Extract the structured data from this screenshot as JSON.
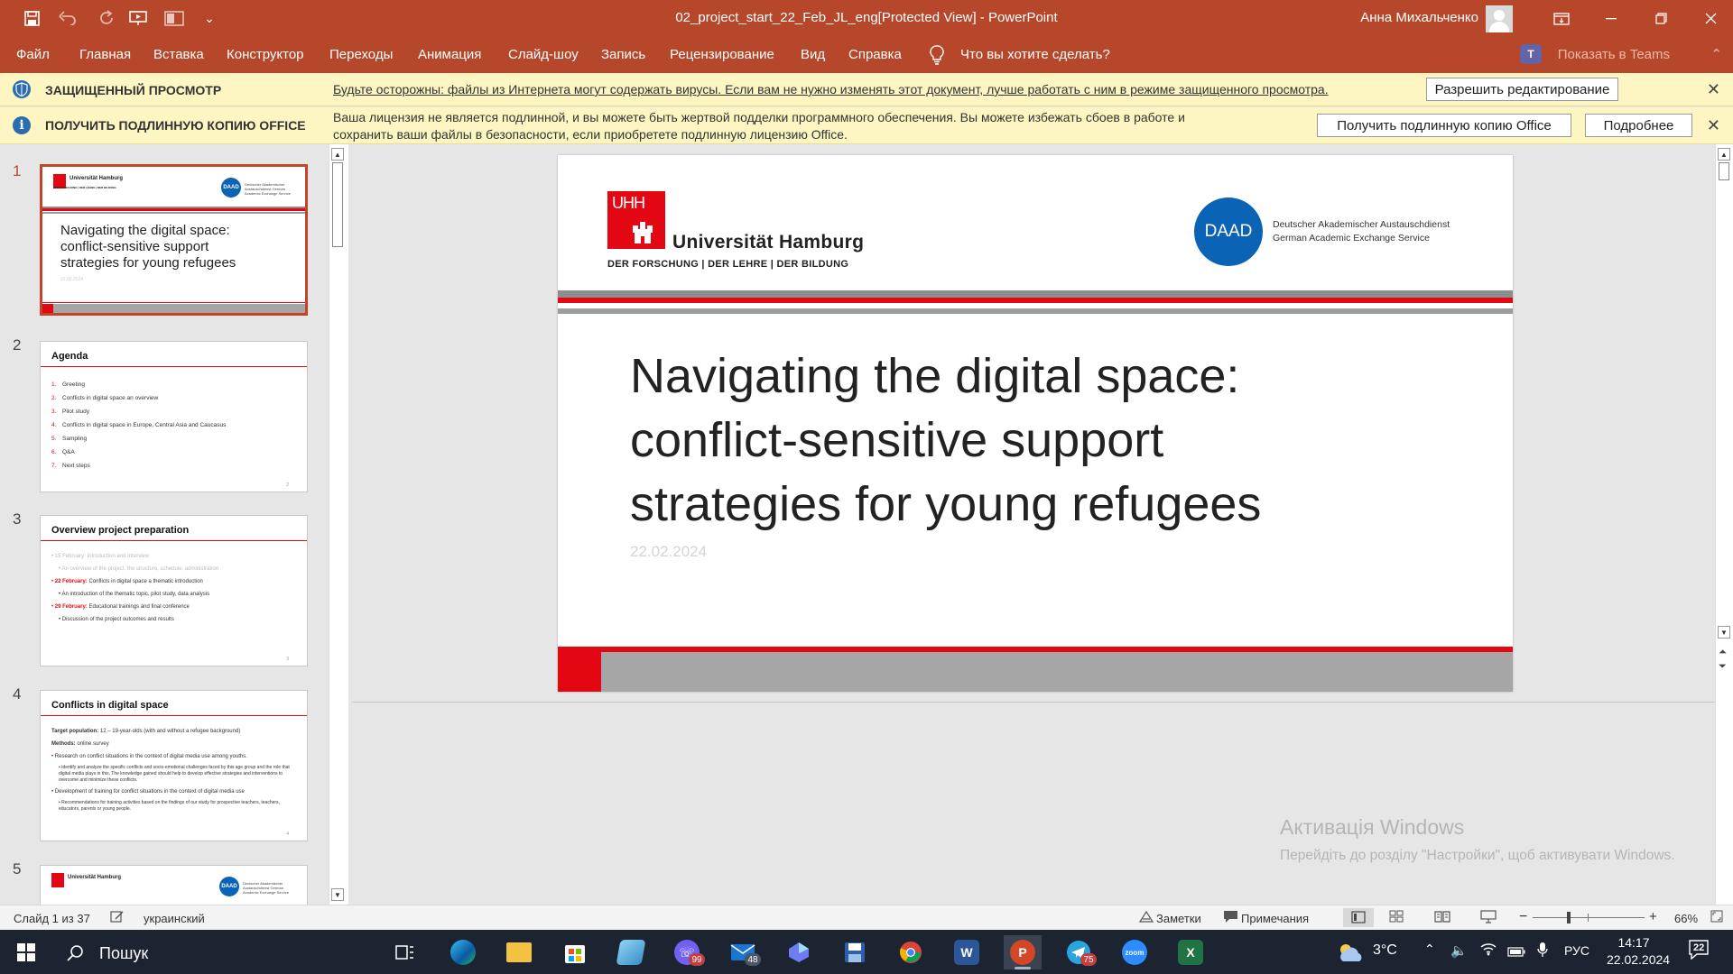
{
  "window": {
    "title": "02_project_start_22_Feb_JL_eng[Protected View]  -  PowerPoint",
    "user_name": "Анна Михальченко"
  },
  "menu": {
    "items": [
      "Файл",
      "Главная",
      "Вставка",
      "Конструктор",
      "Переходы",
      "Анимация",
      "Слайд-шоу",
      "Запись",
      "Рецензирование",
      "Вид",
      "Справка"
    ],
    "tell_me": "Что вы хотите сделать?",
    "teams": "Показать в Teams"
  },
  "protected_bar": {
    "title": "ЗАЩИЩЕННЫЙ ПРОСМОТР",
    "message": "Будьте осторожны: файлы из Интернета могут содержать вирусы. Если вам не нужно изменять этот документ, лучше работать с ним в режиме защищенного просмотра.",
    "button": "Разрешить редактирование"
  },
  "license_bar": {
    "title": "ПОЛУЧИТЬ ПОДЛИННУЮ КОПИЮ OFFICE",
    "line1": "Ваша лицензия не является подлинной, и вы можете быть жертвой подделки программного обеспечения. Вы можете избежать сбоев в работе и",
    "line2": "сохранить ваши файлы в безопасности, если приобретете подлинную лицензию Office.",
    "button_get": "Получить подлинную копию Office",
    "button_more": "Подробнее"
  },
  "thumbnails": {
    "numbers": [
      "1",
      "2",
      "3",
      "4",
      "5"
    ],
    "slide1": {
      "uhh_text": "Universität Hamburg",
      "uhh_motto": "DER FORSCHUNG | DER LEHRE | DER BILDUNG",
      "daad": "DAAD",
      "daad_text": "Deutscher Akademischer Austauschdienst German Academic Exchange Service",
      "title": "Navigating the digital space: conflict-sensitive support strategies for young refugees",
      "date": "22.02.2024"
    },
    "slide2": {
      "title": "Agenda",
      "items": [
        {
          "n": "1.",
          "t": "Greeting"
        },
        {
          "n": "2.",
          "t": "Conflicts in digital space an overview"
        },
        {
          "n": "3.",
          "t": "Pilot study"
        },
        {
          "n": "4.",
          "t": "Conflicts in digital space in Europe, Central Asia and Caucasus"
        },
        {
          "n": "5.",
          "t": "Sampling"
        },
        {
          "n": "6.",
          "t": "Q&A"
        },
        {
          "n": "7.",
          "t": "Next steps"
        }
      ],
      "page": "2"
    },
    "slide3": {
      "title": "Overview project preparation",
      "b1_date": "15 February:",
      "b1": "Introduction and Interview",
      "b1_sub": "An overview of the project, the structure, schedule, administration",
      "b2_date": "22 February:",
      "b2": "Conflicts in digital space a thematic introduction",
      "b2_sub": "An introduction of the thematic topic, pilot study, data analysis",
      "b3_date": "29 February:",
      "b3": "Educational trainings and final conference",
      "b3_sub": "Discussion of the project outcomes and results",
      "page": "3"
    },
    "slide4": {
      "title": "Conflicts in digital space",
      "target_label": "Target population:",
      "target": "12 – 19-year-olds (with and without a refugee background)",
      "methods_label": "Methods:",
      "methods": "online survey",
      "b1": "Research on conflict situations in the context of digital media use among youths.",
      "b1_sub": "Identify and analyze the specific conflicts and socio-emotional challenges faced by this age group and the role that digital media plays in this. The knowledge gained should help to develop effective strategies and interventions to overcome and minimize these conflicts.",
      "b2": "Development of training for conflict situations in the context of digital media use",
      "b2_sub": "Recommendations for training activities based on the findings of our study for prospective teachers, teachers, educators, parents or young people.",
      "page": "4"
    }
  },
  "slide": {
    "uhh_letters": "UHH",
    "uhh_name": "Universität Hamburg",
    "uhh_motto": "DER FORSCHUNG  |  DER LEHRE  |  DER BILDUNG",
    "daad": "DAAD",
    "daad_line1": "Deutscher Akademischer Austauschdienst",
    "daad_line2": "German Academic Exchange Service",
    "title_l1": "Navigating the digital space:",
    "title_l2": "conflict-sensitive support",
    "title_l3": "strategies for young refugees",
    "date": "22.02.2024"
  },
  "watermark": {
    "title": "Активація Windows",
    "sub": "Перейдіть до розділу \"Настройки\", щоб активувати Windows."
  },
  "status": {
    "slide_of": "Слайд 1 из 37",
    "language": "украинский",
    "notes": "Заметки",
    "comments": "Примечания",
    "zoom": "66%"
  },
  "taskbar": {
    "search": "Пошук",
    "temperature": "3°C",
    "lang": "РУС",
    "time": "14:17",
    "date": "22.02.2024",
    "notif_count": "22",
    "viber_badge": "99",
    "mail_badge": "48",
    "telegram_badge": "75"
  },
  "colors": {
    "ppt_red": "#b7472a",
    "uhh_red": "#e30613",
    "daad_blue": "#0b63b6",
    "infobar": "#fdf6c3"
  }
}
